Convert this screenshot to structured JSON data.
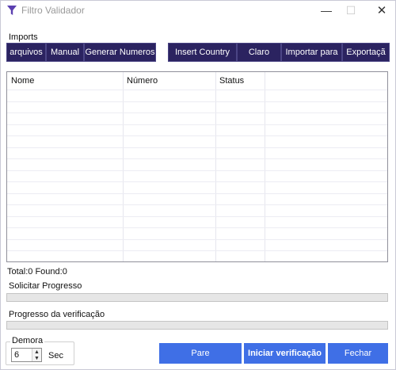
{
  "window": {
    "title": "Filtro Validador",
    "controls": {
      "minimize": "—",
      "maximize": "☐",
      "close": "✕"
    }
  },
  "imports_label": "Imports",
  "toolbar": {
    "left_buttons": [
      "arquivos",
      "Manual",
      "Generar Numeros"
    ],
    "right_buttons": [
      "Insert Country",
      "Claro",
      "Importar para",
      "Exportaçã"
    ]
  },
  "grid": {
    "columns": [
      "Nome",
      "Número",
      "Status"
    ],
    "rows": []
  },
  "stats": "Total:0 Found:0",
  "progress": {
    "request_label": "Solicitar Progresso",
    "request_value": 0,
    "verify_label": "Progresso da verificação",
    "verify_value": 0
  },
  "delay": {
    "legend": "Demora",
    "value": "6",
    "unit": "Sec"
  },
  "actions": {
    "stop": "Pare",
    "start": "Iniciar verificação",
    "close": "Fechar"
  },
  "colors": {
    "nav_button": "#2b2360",
    "action_button": "#3f6fe6",
    "logo": "#5b3fb0"
  },
  "icons": {
    "logo": "funnel-icon"
  }
}
